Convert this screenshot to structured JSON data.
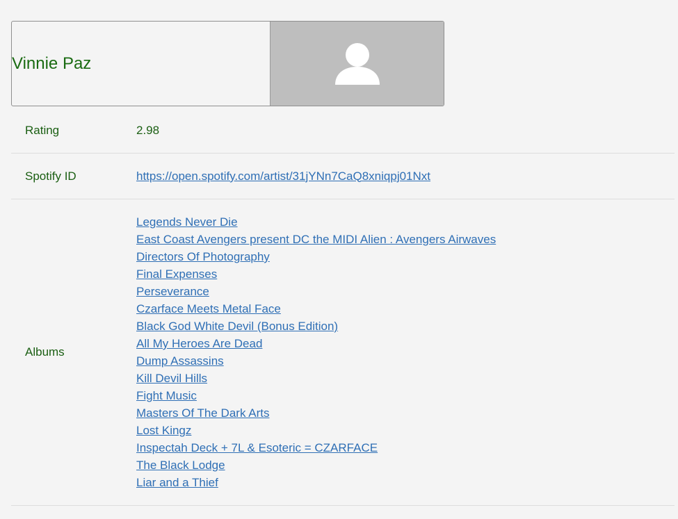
{
  "artist": {
    "name": "Vinnie Paz",
    "photo_icon": "person-placeholder-icon"
  },
  "rating": {
    "label": "Rating",
    "value": "2.98"
  },
  "spotify": {
    "label": "Spotify ID",
    "url": "https://open.spotify.com/artist/31jYNn7CaQ8xniqpj01Nxt"
  },
  "albums": {
    "label": "Albums",
    "items": [
      "Legends Never Die",
      "East Coast Avengers present DC the MIDI Alien : Avengers Airwaves",
      "Directors Of Photography",
      "Final Expenses",
      "Perseverance",
      "Czarface Meets Metal Face",
      "Black God White Devil (Bonus Edition)",
      "All My Heroes Are Dead",
      "Dump Assassins",
      "Kill Devil Hills",
      "Fight Music",
      "Masters Of The Dark Arts",
      "Lost Kingz",
      "Inspectah Deck + 7L & Esoteric = CZARFACE",
      "The Black Lodge",
      "Liar and a Thief"
    ]
  },
  "colors": {
    "text_green": "#1a6b12",
    "link_blue": "#2f6fb5",
    "photo_bg": "#bebebe",
    "page_bg": "#f4f4f4"
  }
}
